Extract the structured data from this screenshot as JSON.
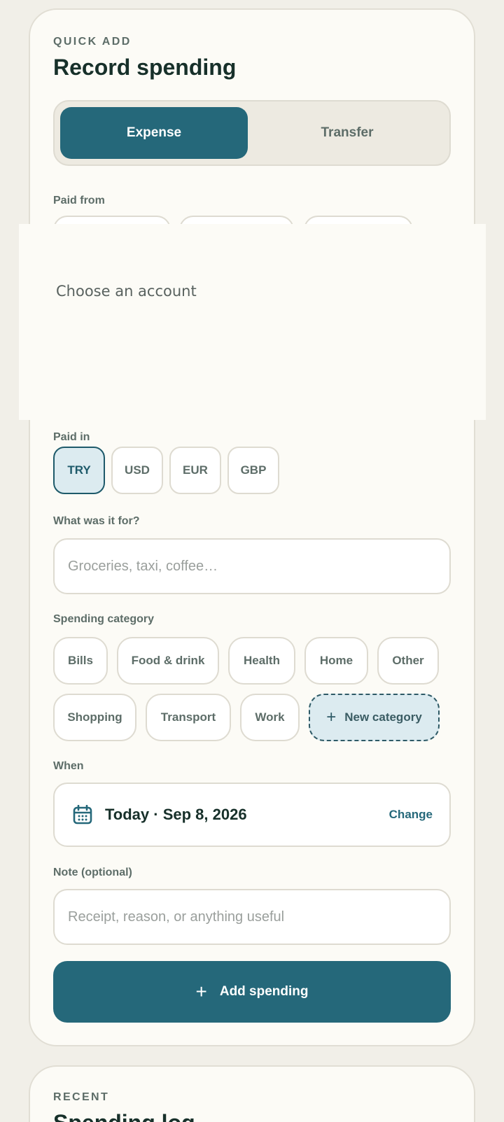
{
  "colors": {
    "background": "#f1efe8",
    "card": "#fcfbf6",
    "accent": "#25687a",
    "selected_chip_bg": "#dcebf0",
    "text_dark": "#17302a",
    "text_muted": "#5d6d68"
  },
  "quick_add": {
    "eyebrow": "QUICK ADD",
    "title": "Record spending"
  },
  "type_toggle": {
    "options": [
      {
        "label": "Expense",
        "selected": true
      },
      {
        "label": "Transfer",
        "selected": false
      }
    ]
  },
  "paid_from": {
    "label": "Paid from",
    "overlay_text": "Choose an account"
  },
  "paid_in": {
    "label": "Paid in",
    "currencies": [
      {
        "label": "TRY",
        "selected": true
      },
      {
        "label": "USD",
        "selected": false
      },
      {
        "label": "EUR",
        "selected": false
      },
      {
        "label": "GBP",
        "selected": false
      }
    ]
  },
  "what_for": {
    "label": "What was it for?",
    "placeholder": "Groceries, taxi, coffee…",
    "value": ""
  },
  "category": {
    "label": "Spending category",
    "items": [
      "Bills",
      "Food & drink",
      "Health",
      "Home",
      "Other",
      "Shopping",
      "Transport",
      "Work"
    ],
    "new_label": "New category"
  },
  "when": {
    "label": "When",
    "icon": "calendar-icon",
    "value": "Today · Sep 8, 2026",
    "change_label": "Change"
  },
  "note": {
    "label": "Note (optional)",
    "placeholder": "Receipt, reason, or anything useful",
    "value": ""
  },
  "submit": {
    "label": "Add spending",
    "icon": "plus-icon"
  },
  "recent": {
    "eyebrow": "RECENT",
    "title": "Spending log"
  }
}
